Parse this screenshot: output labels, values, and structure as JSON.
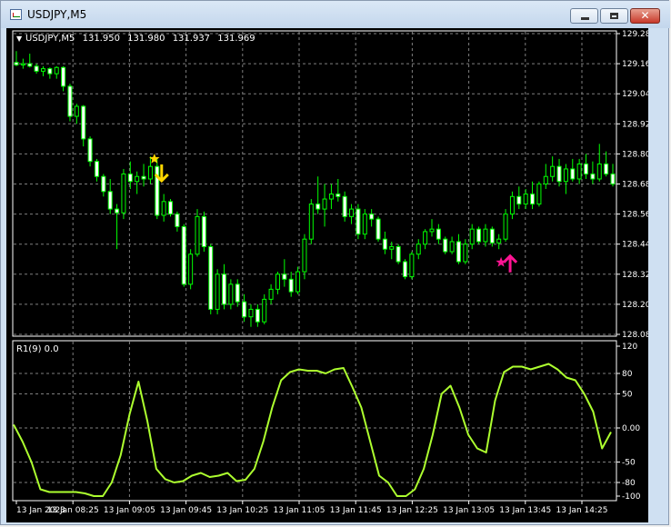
{
  "window": {
    "title": "USDJPY,M5",
    "icon": "chart-window-icon",
    "controls": {
      "minimize_icon": "minimize-icon",
      "maximize_icon": "maximize-icon",
      "close_icon": "close-icon",
      "close_glyph": "✕"
    }
  },
  "colors": {
    "background": "#000000",
    "grid": "#7f7f7f",
    "text": "#ffffff",
    "candle_up_fill": "#000000",
    "candle_down_fill": "#ffffff",
    "wick": "#00ff00",
    "indicator_line": "#adff2f",
    "sell_arrow": "#ffd700",
    "sell_star": "#ffd700",
    "buy_arrow": "#ff1493",
    "buy_star": "#ff1493"
  },
  "price_panel": {
    "header": {
      "menu_glyph": "▼",
      "symbol": "USDJPY,M5",
      "open": "131.950",
      "high": "131.980",
      "low": "131.937",
      "close": "131.969"
    },
    "y_ticks": [
      "129.280",
      "129.160",
      "129.040",
      "128.920",
      "128.800",
      "128.680",
      "128.560",
      "128.440",
      "128.320",
      "128.200",
      "128.080"
    ]
  },
  "indicator_panel": {
    "label": "R1(9) 0.0",
    "y_ticks": [
      "120",
      "80",
      "50",
      "0.00",
      "-50",
      "-80",
      "-100"
    ]
  },
  "x_axis": {
    "ticks": [
      "13 Jan 2023",
      "13 Jan 08:25",
      "13 Jan 09:05",
      "13 Jan 09:45",
      "13 Jan 10:25",
      "13 Jan 11:05",
      "13 Jan 11:45",
      "13 Jan 12:25",
      "13 Jan 13:05",
      "13 Jan 13:45",
      "13 Jan 14:25"
    ]
  },
  "chart_data": [
    {
      "type": "candlestick",
      "title": "USDJPY,M5",
      "ylim": [
        128.08,
        129.28
      ],
      "candles": [
        {
          "o": 129.165,
          "h": 129.21,
          "l": 129.15,
          "c": 129.155
        },
        {
          "o": 129.155,
          "h": 129.18,
          "l": 129.14,
          "c": 129.16
        },
        {
          "o": 129.16,
          "h": 129.2,
          "l": 129.145,
          "c": 129.15
        },
        {
          "o": 129.15,
          "h": 129.16,
          "l": 129.12,
          "c": 129.13
        },
        {
          "o": 129.13,
          "h": 129.15,
          "l": 129.11,
          "c": 129.14
        },
        {
          "o": 129.14,
          "h": 129.145,
          "l": 129.1,
          "c": 129.12
        },
        {
          "o": 129.12,
          "h": 129.15,
          "l": 129.1,
          "c": 129.145
        },
        {
          "o": 129.145,
          "h": 129.15,
          "l": 129.05,
          "c": 129.07
        },
        {
          "o": 129.07,
          "h": 129.08,
          "l": 128.93,
          "c": 128.95
        },
        {
          "o": 128.95,
          "h": 129.0,
          "l": 128.92,
          "c": 128.99
        },
        {
          "o": 128.99,
          "h": 128.995,
          "l": 128.83,
          "c": 128.86
        },
        {
          "o": 128.86,
          "h": 128.87,
          "l": 128.75,
          "c": 128.77
        },
        {
          "o": 128.77,
          "h": 128.78,
          "l": 128.69,
          "c": 128.71
        },
        {
          "o": 128.71,
          "h": 128.72,
          "l": 128.63,
          "c": 128.65
        },
        {
          "o": 128.65,
          "h": 128.7,
          "l": 128.56,
          "c": 128.58
        },
        {
          "o": 128.58,
          "h": 128.6,
          "l": 128.42,
          "c": 128.565
        },
        {
          "o": 128.565,
          "h": 128.74,
          "l": 128.54,
          "c": 128.72
        },
        {
          "o": 128.72,
          "h": 128.77,
          "l": 128.66,
          "c": 128.69
        },
        {
          "o": 128.69,
          "h": 128.73,
          "l": 128.64,
          "c": 128.71
        },
        {
          "o": 128.71,
          "h": 128.76,
          "l": 128.67,
          "c": 128.7
        },
        {
          "o": 128.7,
          "h": 128.79,
          "l": 128.68,
          "c": 128.75
        },
        {
          "o": 128.75,
          "h": 128.78,
          "l": 128.54,
          "c": 128.555
        },
        {
          "o": 128.555,
          "h": 128.64,
          "l": 128.53,
          "c": 128.61
        },
        {
          "o": 128.61,
          "h": 128.62,
          "l": 128.55,
          "c": 128.56
        },
        {
          "o": 128.56,
          "h": 128.57,
          "l": 128.49,
          "c": 128.51
        },
        {
          "o": 128.51,
          "h": 128.52,
          "l": 128.27,
          "c": 128.28
        },
        {
          "o": 128.28,
          "h": 128.42,
          "l": 128.26,
          "c": 128.4
        },
        {
          "o": 128.4,
          "h": 128.58,
          "l": 128.39,
          "c": 128.55
        },
        {
          "o": 128.55,
          "h": 128.57,
          "l": 128.41,
          "c": 128.43
        },
        {
          "o": 128.43,
          "h": 128.44,
          "l": 128.16,
          "c": 128.18
        },
        {
          "o": 128.18,
          "h": 128.34,
          "l": 128.16,
          "c": 128.32
        },
        {
          "o": 128.32,
          "h": 128.36,
          "l": 128.18,
          "c": 128.2
        },
        {
          "o": 128.2,
          "h": 128.3,
          "l": 128.18,
          "c": 128.28
        },
        {
          "o": 128.28,
          "h": 128.3,
          "l": 128.19,
          "c": 128.21
        },
        {
          "o": 128.21,
          "h": 128.24,
          "l": 128.13,
          "c": 128.15
        },
        {
          "o": 128.15,
          "h": 128.2,
          "l": 128.11,
          "c": 128.18
        },
        {
          "o": 128.18,
          "h": 128.2,
          "l": 128.11,
          "c": 128.13
        },
        {
          "o": 128.13,
          "h": 128.24,
          "l": 128.12,
          "c": 128.22
        },
        {
          "o": 128.22,
          "h": 128.28,
          "l": 128.2,
          "c": 128.26
        },
        {
          "o": 128.26,
          "h": 128.33,
          "l": 128.24,
          "c": 128.32
        },
        {
          "o": 128.32,
          "h": 128.38,
          "l": 128.27,
          "c": 128.3
        },
        {
          "o": 128.3,
          "h": 128.33,
          "l": 128.23,
          "c": 128.25
        },
        {
          "o": 128.25,
          "h": 128.35,
          "l": 128.24,
          "c": 128.33
        },
        {
          "o": 128.33,
          "h": 128.48,
          "l": 128.3,
          "c": 128.46
        },
        {
          "o": 128.46,
          "h": 128.62,
          "l": 128.44,
          "c": 128.6
        },
        {
          "o": 128.6,
          "h": 128.71,
          "l": 128.56,
          "c": 128.58
        },
        {
          "o": 128.58,
          "h": 128.68,
          "l": 128.51,
          "c": 128.62
        },
        {
          "o": 128.62,
          "h": 128.68,
          "l": 128.58,
          "c": 128.64
        },
        {
          "o": 128.64,
          "h": 128.7,
          "l": 128.61,
          "c": 128.63
        },
        {
          "o": 128.63,
          "h": 128.65,
          "l": 128.53,
          "c": 128.55
        },
        {
          "o": 128.55,
          "h": 128.6,
          "l": 128.52,
          "c": 128.58
        },
        {
          "o": 128.58,
          "h": 128.6,
          "l": 128.46,
          "c": 128.48
        },
        {
          "o": 128.48,
          "h": 128.58,
          "l": 128.46,
          "c": 128.56
        },
        {
          "o": 128.56,
          "h": 128.58,
          "l": 128.51,
          "c": 128.54
        },
        {
          "o": 128.54,
          "h": 128.55,
          "l": 128.45,
          "c": 128.46
        },
        {
          "o": 128.46,
          "h": 128.49,
          "l": 128.4,
          "c": 128.42
        },
        {
          "o": 128.42,
          "h": 128.45,
          "l": 128.38,
          "c": 128.43
        },
        {
          "o": 128.43,
          "h": 128.44,
          "l": 128.36,
          "c": 128.37
        },
        {
          "o": 128.37,
          "h": 128.38,
          "l": 128.3,
          "c": 128.31
        },
        {
          "o": 128.31,
          "h": 128.41,
          "l": 128.3,
          "c": 128.4
        },
        {
          "o": 128.4,
          "h": 128.46,
          "l": 128.38,
          "c": 128.44
        },
        {
          "o": 128.44,
          "h": 128.5,
          "l": 128.42,
          "c": 128.49
        },
        {
          "o": 128.49,
          "h": 128.54,
          "l": 128.47,
          "c": 128.5
        },
        {
          "o": 128.5,
          "h": 128.52,
          "l": 128.44,
          "c": 128.46
        },
        {
          "o": 128.46,
          "h": 128.47,
          "l": 128.4,
          "c": 128.41
        },
        {
          "o": 128.41,
          "h": 128.47,
          "l": 128.4,
          "c": 128.45
        },
        {
          "o": 128.45,
          "h": 128.48,
          "l": 128.36,
          "c": 128.37
        },
        {
          "o": 128.37,
          "h": 128.46,
          "l": 128.36,
          "c": 128.44
        },
        {
          "o": 128.44,
          "h": 128.52,
          "l": 128.42,
          "c": 128.5
        },
        {
          "o": 128.5,
          "h": 128.51,
          "l": 128.44,
          "c": 128.45
        },
        {
          "o": 128.45,
          "h": 128.52,
          "l": 128.43,
          "c": 128.5
        },
        {
          "o": 128.5,
          "h": 128.51,
          "l": 128.43,
          "c": 128.445
        },
        {
          "o": 128.445,
          "h": 128.48,
          "l": 128.42,
          "c": 128.46
        },
        {
          "o": 128.46,
          "h": 128.58,
          "l": 128.45,
          "c": 128.56
        },
        {
          "o": 128.56,
          "h": 128.65,
          "l": 128.54,
          "c": 128.63
        },
        {
          "o": 128.63,
          "h": 128.67,
          "l": 128.58,
          "c": 128.6
        },
        {
          "o": 128.6,
          "h": 128.66,
          "l": 128.58,
          "c": 128.64
        },
        {
          "o": 128.64,
          "h": 128.69,
          "l": 128.58,
          "c": 128.6
        },
        {
          "o": 128.6,
          "h": 128.69,
          "l": 128.59,
          "c": 128.68
        },
        {
          "o": 128.68,
          "h": 128.76,
          "l": 128.66,
          "c": 128.71
        },
        {
          "o": 128.71,
          "h": 128.79,
          "l": 128.69,
          "c": 128.75
        },
        {
          "o": 128.75,
          "h": 128.78,
          "l": 128.67,
          "c": 128.69
        },
        {
          "o": 128.69,
          "h": 128.76,
          "l": 128.64,
          "c": 128.74
        },
        {
          "o": 128.74,
          "h": 128.78,
          "l": 128.69,
          "c": 128.7
        },
        {
          "o": 128.7,
          "h": 128.78,
          "l": 128.68,
          "c": 128.76
        },
        {
          "o": 128.76,
          "h": 128.8,
          "l": 128.7,
          "c": 128.72
        },
        {
          "o": 128.72,
          "h": 128.77,
          "l": 128.68,
          "c": 128.7
        },
        {
          "o": 128.7,
          "h": 128.84,
          "l": 128.69,
          "c": 128.76
        },
        {
          "o": 128.76,
          "h": 128.81,
          "l": 128.71,
          "c": 128.72
        },
        {
          "o": 128.72,
          "h": 128.76,
          "l": 128.67,
          "c": 128.68
        }
      ],
      "markers": [
        {
          "type": "sell",
          "candle": 21,
          "price": 128.7
        },
        {
          "type": "buy",
          "candle": 73,
          "price": 128.36
        }
      ]
    },
    {
      "type": "line",
      "title": "R1(9) 0.0",
      "ylim": [
        -100,
        120
      ],
      "series": [
        {
          "values": [
            5,
            -20,
            -50,
            -90,
            -94,
            -94,
            -94,
            -94,
            -96,
            -100,
            -100,
            -80,
            -40,
            20,
            68,
            10,
            -60,
            -75,
            -80,
            -78,
            -70,
            -66,
            -72,
            -70,
            -66,
            -78,
            -76,
            -60,
            -20,
            30,
            70,
            82,
            86,
            84,
            84,
            80,
            86,
            88,
            60,
            30,
            -20,
            -70,
            -80,
            -100,
            -100,
            -90,
            -60,
            -10,
            50,
            62,
            30,
            -10,
            -30,
            -36,
            40,
            82,
            90,
            90,
            86,
            90,
            94,
            86,
            74,
            70,
            50,
            24,
            -30,
            -6
          ]
        }
      ]
    }
  ]
}
